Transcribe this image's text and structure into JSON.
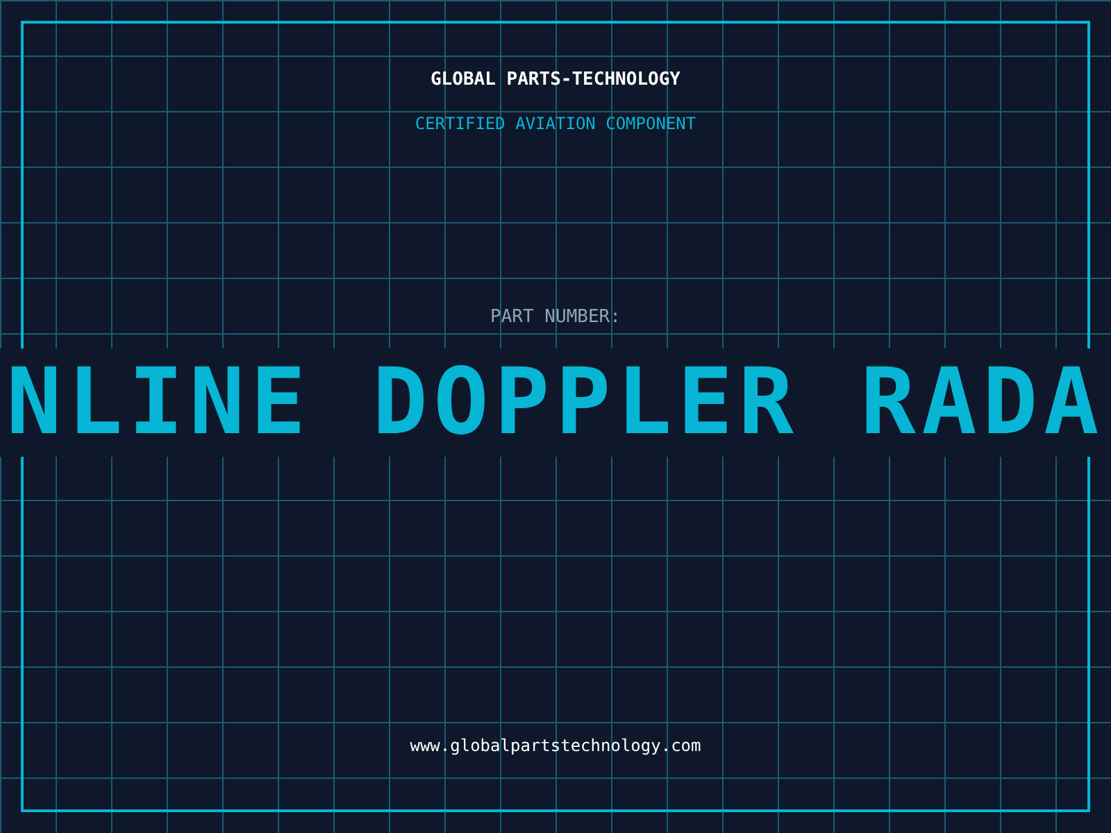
{
  "brand": {
    "title": "GLOBAL PARTS-TECHNOLOGY",
    "subtitle": "CERTIFIED AVIATION COMPONENT"
  },
  "part": {
    "label": "PART NUMBER:",
    "value": "NLINE DOPPLER RADA"
  },
  "website": "www.globalpartstechnology.com"
}
